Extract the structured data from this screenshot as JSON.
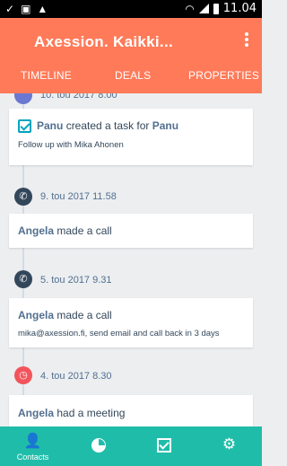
{
  "status_bar": {
    "time": "11.04"
  },
  "header": {
    "title": "Axession. Kaikki...",
    "tabs": [
      "TIMELINE",
      "DEALS",
      "PROPERTIES"
    ]
  },
  "timeline": [
    {
      "date": "10. tou 2017 8.00",
      "icon": "task-icon"
    },
    {
      "actor": "Panu",
      "action": "created a task for",
      "target": "Panu",
      "detail": "Follow up with Mika Ahonen"
    },
    {
      "date": "9. tou 2017 11.58",
      "icon": "phone-icon"
    },
    {
      "actor": "Angela",
      "action": "made a call"
    },
    {
      "date": "5. tou 2017 9.31",
      "icon": "phone-icon"
    },
    {
      "actor": "Angela",
      "action": "made a call",
      "detail": "mika@axession.fi, send email and call back in 3 days"
    },
    {
      "date": "4. tou 2017 8.30",
      "icon": "meeting-clock-icon"
    },
    {
      "actor": "Angela",
      "action": "had a meeting"
    }
  ],
  "bottom_nav": {
    "items": [
      {
        "label": "Contacts",
        "icon": "contacts-icon"
      },
      {
        "label": "",
        "icon": "reports-pie-icon"
      },
      {
        "label": "",
        "icon": "tasks-check-icon"
      },
      {
        "label": "",
        "icon": "settings-gear-icon"
      }
    ]
  },
  "colors": {
    "header": "#ff7a59",
    "nav": "#1fbda9",
    "accent": "#00a4bd"
  }
}
